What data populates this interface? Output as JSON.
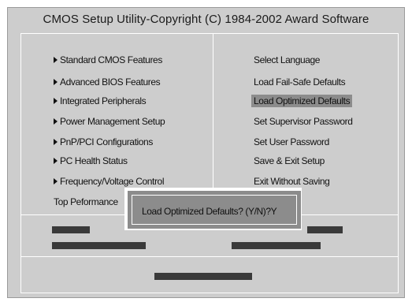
{
  "title": "CMOS Setup Utility-Copyright (C) 1984-2002 Award Software",
  "left_menu": [
    {
      "label": "Standard CMOS Features",
      "submenu": true
    },
    {
      "label": "Advanced BIOS Features",
      "submenu": true
    },
    {
      "label": "Integrated Peripherals",
      "submenu": true
    },
    {
      "label": "Power Management Setup",
      "submenu": true
    },
    {
      "label": "PnP/PCI Configurations",
      "submenu": true
    },
    {
      "label": "PC Health Status",
      "submenu": true
    },
    {
      "label": "Frequency/Voltage Control",
      "submenu": true
    },
    {
      "label": "Top Peformance",
      "submenu": false
    }
  ],
  "right_menu": [
    {
      "label": "Select Language"
    },
    {
      "label": "Load Fail-Safe Defaults"
    },
    {
      "label": "Load Optimized Defaults",
      "selected": true
    },
    {
      "label": "Set Supervisor Password"
    },
    {
      "label": "Set User Password"
    },
    {
      "label": "Save & Exit Setup"
    },
    {
      "label": "Exit Without Saving"
    }
  ],
  "dialog": {
    "message": "Load Optimized Defaults? (Y/N)?Y"
  },
  "colors": {
    "background": "#cdcdcd",
    "highlight": "#8c8c8c",
    "dialog": "#8c8c8c",
    "bars": "#3a3a3a"
  }
}
